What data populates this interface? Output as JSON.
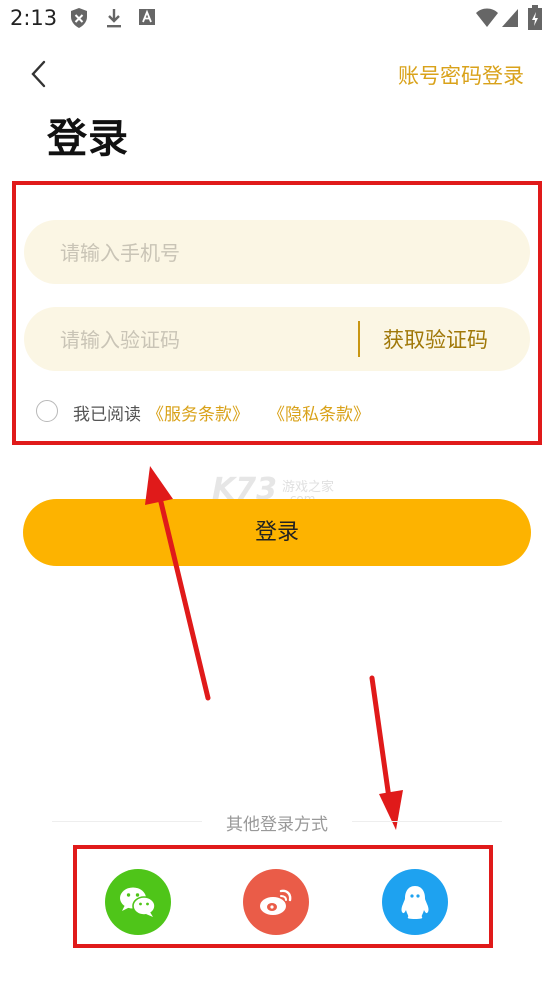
{
  "status_bar": {
    "time": "2:13",
    "icons": [
      "shield-icon",
      "download-icon",
      "a-icon",
      "wifi-icon",
      "signal-icon",
      "battery-charging-icon"
    ]
  },
  "header": {
    "back_icon": "chevron-left-icon",
    "password_login_label": "账号密码登录",
    "title": "登录"
  },
  "form": {
    "phone_placeholder": "请输入手机号",
    "phone_value": "",
    "code_placeholder": "请输入验证码",
    "code_value": "",
    "get_code_label": "获取验证码",
    "agree_prefix": "我已阅读",
    "terms_link": "《服务条款》",
    "privacy_link": "《隐私条款》"
  },
  "login_button_label": "登录",
  "watermark": {
    "brand": "K73",
    "tagline": "游戏之家",
    "suffix": ".com"
  },
  "other_login": {
    "label": "其他登录方式",
    "methods": [
      {
        "name": "wechat",
        "icon": "wechat-icon",
        "color": "#4fc519"
      },
      {
        "name": "weibo",
        "icon": "weibo-icon",
        "color": "#ea5c48"
      },
      {
        "name": "qq",
        "icon": "qq-icon",
        "color": "#1ea2f0"
      }
    ]
  },
  "colors": {
    "accent": "#fdb300",
    "link": "#d9a21a",
    "input_bg": "#fbf6e4",
    "annotation": "#e01a1a"
  }
}
